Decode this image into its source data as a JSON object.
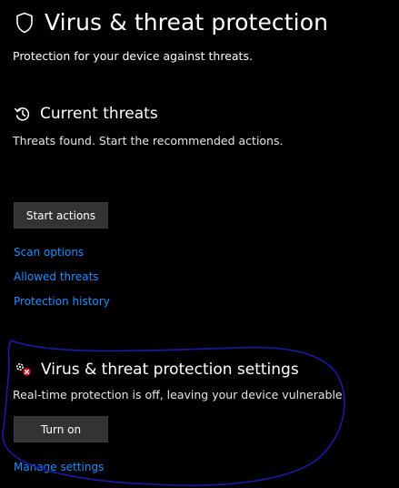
{
  "header": {
    "title": "Virus & threat protection",
    "subtitle": "Protection for your device against threats.",
    "icon": "shield-icon"
  },
  "current_threats": {
    "title": "Current threats",
    "description": "Threats found. Start the recommended actions.",
    "icon": "threat-history-icon",
    "start_button": "Start actions"
  },
  "links": {
    "scan_options": "Scan options",
    "allowed_threats": "Allowed threats",
    "protection_history": "Protection history"
  },
  "settings": {
    "title": "Virus & threat protection settings",
    "description": "Real-time protection is off, leaving your device vulnerable.",
    "icon": "settings-warning-icon",
    "turn_on_button": "Turn on",
    "manage_link": "Manage settings"
  },
  "colors": {
    "background": "#000000",
    "link": "#1f8fff",
    "button": "#333333",
    "annotation": "#1a1aa6",
    "warning": "#e81123"
  }
}
